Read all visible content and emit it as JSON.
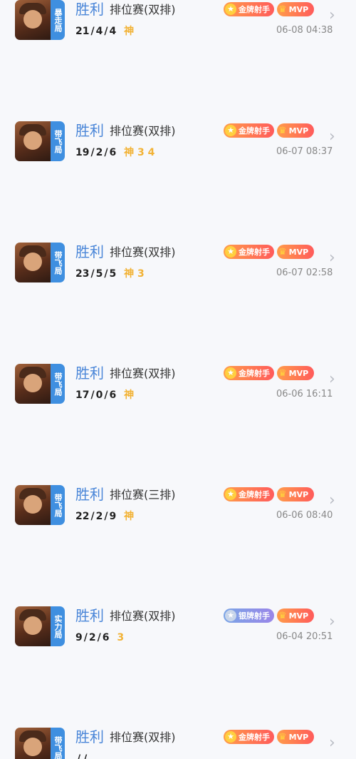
{
  "matches": [
    {
      "tag": "暴走局",
      "result": "胜利",
      "mode": "排位赛(双排)",
      "kda": [
        "21",
        "4",
        "4"
      ],
      "honors": [
        "神"
      ],
      "rank_badge": "金牌射手",
      "rank_type": "gold",
      "mvp": "MVP",
      "time": "06-08 04:38"
    },
    {
      "tag": "带飞局",
      "result": "胜利",
      "mode": "排位赛(双排)",
      "kda": [
        "19",
        "2",
        "6"
      ],
      "honors": [
        "神",
        "3",
        "4"
      ],
      "rank_badge": "金牌射手",
      "rank_type": "gold",
      "mvp": "MVP",
      "time": "06-07 08:37"
    },
    {
      "tag": "带飞局",
      "result": "胜利",
      "mode": "排位赛(双排)",
      "kda": [
        "23",
        "5",
        "5"
      ],
      "honors": [
        "神",
        "3"
      ],
      "rank_badge": "金牌射手",
      "rank_type": "gold",
      "mvp": "MVP",
      "time": "06-07 02:58"
    },
    {
      "tag": "带飞局",
      "result": "胜利",
      "mode": "排位赛(双排)",
      "kda": [
        "17",
        "0",
        "6"
      ],
      "honors": [
        "神"
      ],
      "rank_badge": "金牌射手",
      "rank_type": "gold",
      "mvp": "MVP",
      "time": "06-06 16:11"
    },
    {
      "tag": "带飞局",
      "result": "胜利",
      "mode": "排位赛(三排)",
      "kda": [
        "22",
        "2",
        "9"
      ],
      "honors": [
        "神"
      ],
      "rank_badge": "金牌射手",
      "rank_type": "gold",
      "mvp": "MVP",
      "time": "06-06 08:40"
    },
    {
      "tag": "实力局",
      "result": "胜利",
      "mode": "排位赛(双排)",
      "kda": [
        "9",
        "2",
        "6"
      ],
      "honors": [
        "3"
      ],
      "rank_badge": "银牌射手",
      "rank_type": "silver",
      "mvp": "MVP",
      "time": "06-04 20:51"
    },
    {
      "tag": "带飞局",
      "result": "胜利",
      "mode": "排位赛(双排)",
      "kda": [
        "",
        "",
        ""
      ],
      "honors": [],
      "rank_badge": "金牌射手",
      "rank_type": "gold",
      "mvp": "MVP",
      "time": ""
    }
  ],
  "icons": {
    "chevron": "chevron-right-icon",
    "star": "star-icon",
    "cup": "trophy-icon"
  },
  "colors": {
    "result": "#4a86d8",
    "tag_bg": "#3f8fe0",
    "honor": "#f2b234"
  }
}
